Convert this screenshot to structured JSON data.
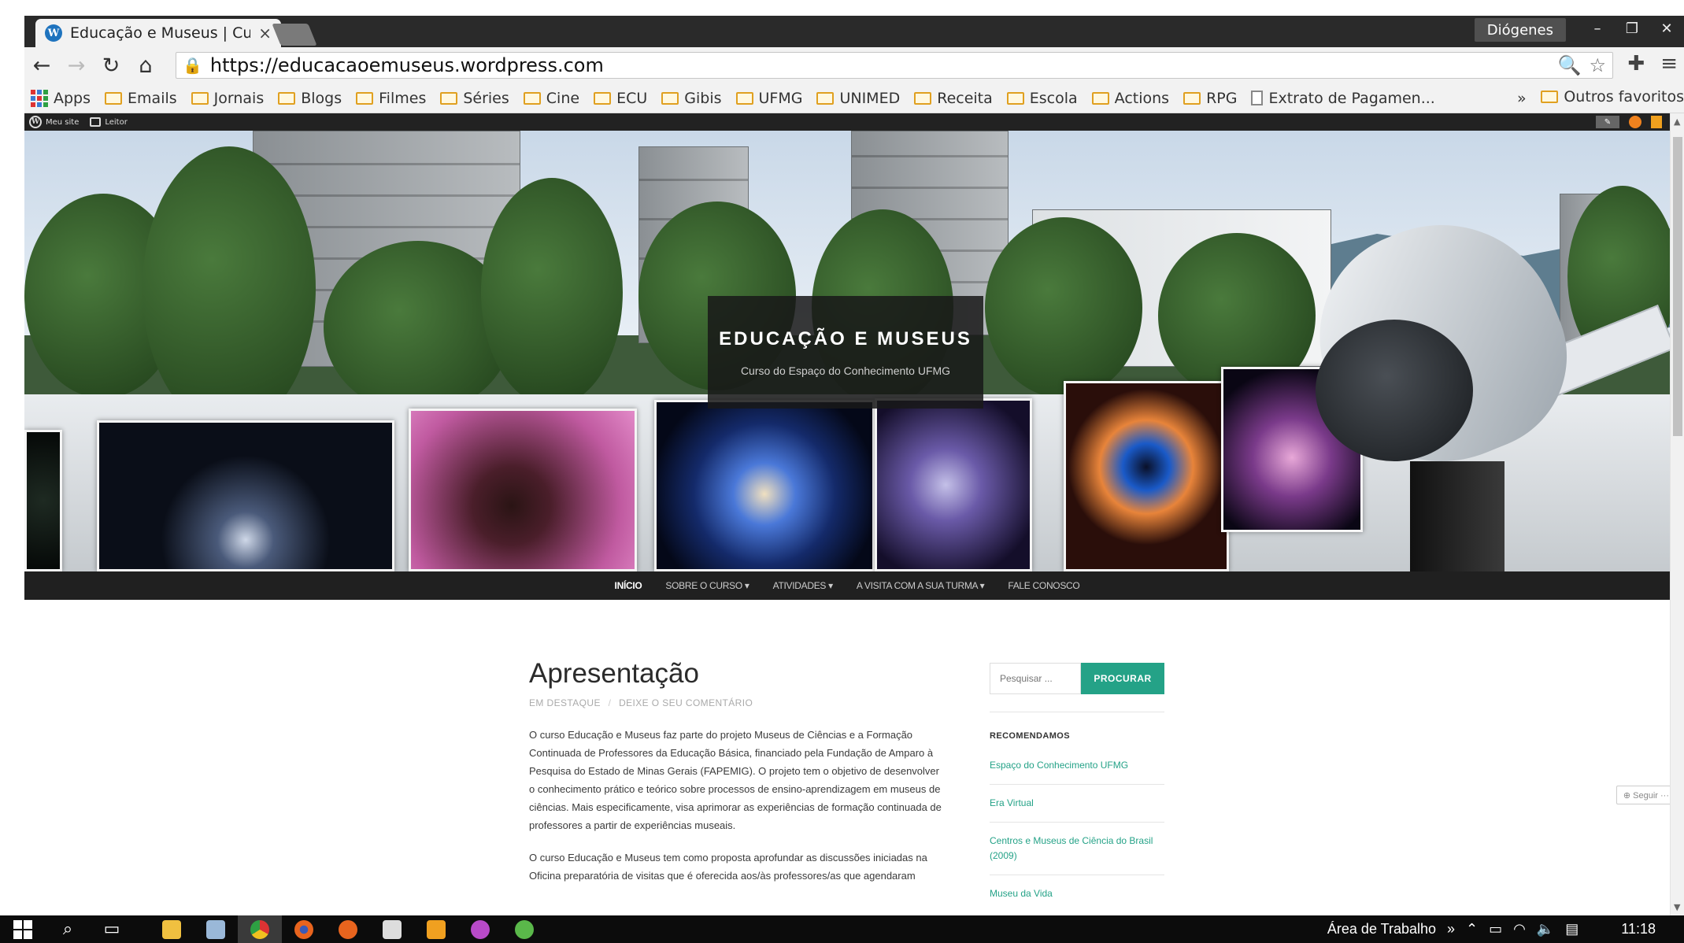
{
  "browser": {
    "tab_title": "Educação e Museus | Curs",
    "tab_favicon_letter": "W",
    "window_user": "Diógenes",
    "url": "https://educacaoemuseus.wordpress.com",
    "bookmarks": [
      {
        "label": "Apps",
        "icon": "apps-grid-icon"
      },
      {
        "label": "Emails",
        "icon": "folder-icon"
      },
      {
        "label": "Jornais",
        "icon": "folder-icon"
      },
      {
        "label": "Blogs",
        "icon": "folder-icon"
      },
      {
        "label": "Filmes",
        "icon": "folder-icon"
      },
      {
        "label": "Séries",
        "icon": "folder-icon"
      },
      {
        "label": "Cine",
        "icon": "folder-icon"
      },
      {
        "label": "ECU",
        "icon": "folder-icon"
      },
      {
        "label": "Gibis",
        "icon": "folder-icon"
      },
      {
        "label": "UFMG",
        "icon": "folder-icon"
      },
      {
        "label": "UNIMED",
        "icon": "folder-icon"
      },
      {
        "label": "Receita",
        "icon": "folder-icon"
      },
      {
        "label": "Escola",
        "icon": "folder-icon"
      },
      {
        "label": "Actions",
        "icon": "folder-icon"
      },
      {
        "label": "RPG",
        "icon": "folder-icon"
      },
      {
        "label": "Extrato de Pagamen...",
        "icon": "page-icon"
      }
    ],
    "bookmarks_overflow": "»",
    "other_bookmarks": "Outros favoritos"
  },
  "wp_admin": {
    "my_site": "Meu site",
    "reader": "Leitor"
  },
  "site": {
    "title": "EDUCAÇÃO E MUSEUS",
    "description": "Curso do Espaço do Conhecimento UFMG",
    "nav": [
      {
        "label": "INÍCIO",
        "active": true
      },
      {
        "label": "SOBRE O CURSO ▾",
        "active": false
      },
      {
        "label": "ATIVIDADES ▾",
        "active": false
      },
      {
        "label": "A VISITA COM A SUA TURMA ▾",
        "active": false
      },
      {
        "label": "FALE CONOSCO",
        "active": false
      }
    ]
  },
  "post": {
    "title": "Apresentação",
    "category": "EM DESTAQUE",
    "meta_sep": "/",
    "comment_link": "DEIXE O SEU COMENTÁRIO",
    "paragraphs": [
      "O curso Educação e Museus faz parte do projeto Museus de Ciências e a Formação Continuada de Professores da Educação Básica, financiado pela Fundação de Amparo à Pesquisa do Estado de Minas Gerais (FAPEMIG). O projeto tem o objetivo de desenvolver o conhecimento prático e teórico sobre processos de ensino-aprendizagem em museus de ciências. Mais especificamente, visa aprimorar as experiências de formação continuada de professores a partir de experiências museais.",
      "O curso Educação e Museus tem como proposta aprofundar as discussões iniciadas na Oficina preparatória de visitas que é oferecida aos/às professores/as que agendaram"
    ]
  },
  "sidebar": {
    "search_placeholder": "Pesquisar ...",
    "search_button": "PROCURAR",
    "widget_title": "RECOMENDAMOS",
    "recommended": [
      "Espaço do Conhecimento UFMG",
      "Era Virtual",
      "Centros e Museus de Ciência do Brasil (2009)",
      "Museu da Vida"
    ]
  },
  "follow_button": "⊕ Seguir ···",
  "taskbar": {
    "desktop_label": "Área de Trabalho",
    "chevron": "»",
    "time": "11:18"
  },
  "colors": {
    "accent": "#24a287",
    "nav_bg": "#202020",
    "wp_bar": "#222222",
    "tabstrip": "#2a2a2a"
  }
}
